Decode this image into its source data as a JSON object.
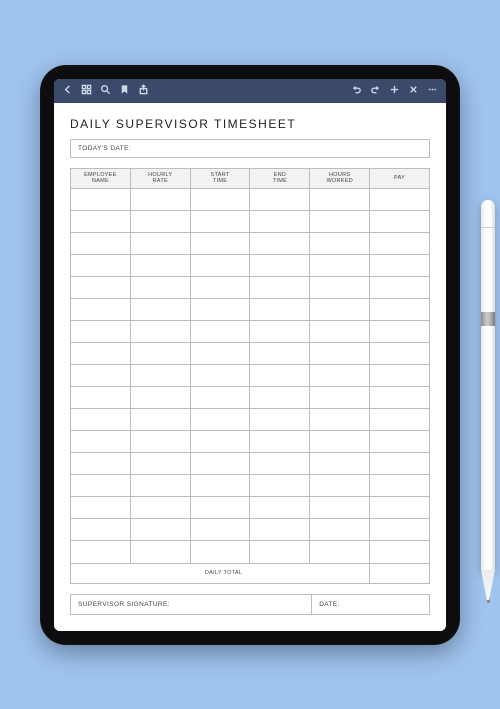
{
  "toolbar": {
    "icons_left": [
      "back",
      "grid",
      "search",
      "bookmark",
      "share"
    ],
    "icons_right": [
      "undo",
      "redo",
      "add",
      "close",
      "more"
    ]
  },
  "document": {
    "title": "DAILY SUPERVISOR TIMESHEET",
    "today_label": "TODAY'S DATE:",
    "columns": [
      "EMPLOYEE NAME",
      "HOURLY RATE",
      "START TIME",
      "END TIME",
      "HOURS WORKED",
      "PAY"
    ],
    "row_count": 17,
    "daily_total_label": "DAILY TOTAL",
    "signature_label": "SUPERVISOR SIGNATURE:",
    "sig_date_label": "DATE:"
  }
}
